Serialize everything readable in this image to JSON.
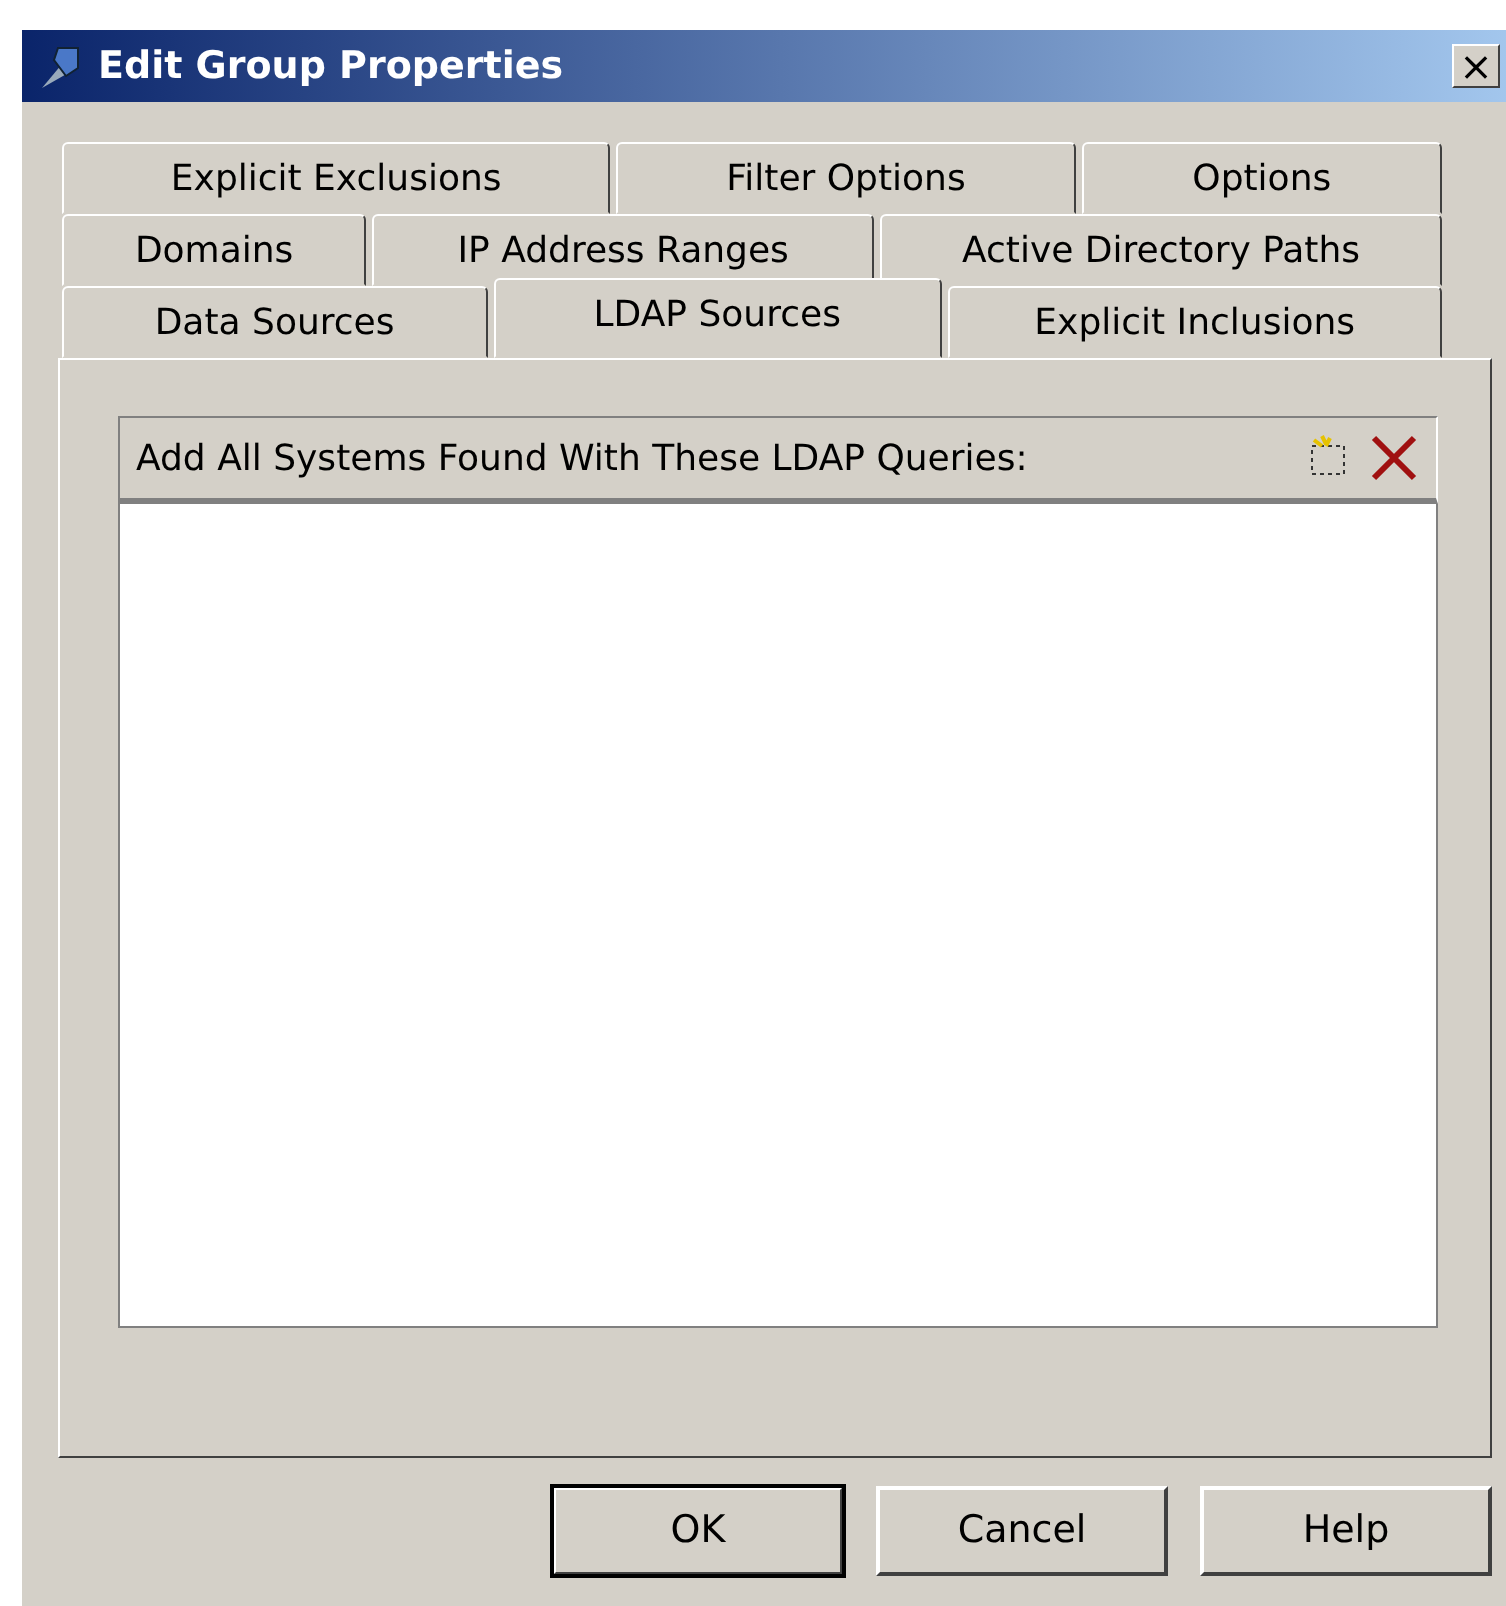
{
  "window": {
    "title": "Edit Group Properties",
    "close": "×"
  },
  "tab_rows": [
    {
      "tabs": [
        {
          "label": "Explicit Exclusions",
          "selected": false
        },
        {
          "label": "Filter Options",
          "selected": false
        },
        {
          "label": "Options",
          "selected": false
        }
      ]
    },
    {
      "tabs": [
        {
          "label": "Domains",
          "selected": false
        },
        {
          "label": "IP Address Ranges",
          "selected": false
        },
        {
          "label": "Active Directory Paths",
          "selected": false
        }
      ]
    },
    {
      "tabs": [
        {
          "label": "Data Sources",
          "selected": false
        },
        {
          "label": "LDAP Sources",
          "selected": true
        },
        {
          "label": "Explicit Inclusions",
          "selected": false
        }
      ]
    }
  ],
  "list": {
    "header": "Add All Systems Found With These LDAP Queries:"
  },
  "buttons": [
    {
      "label": "OK",
      "default": true
    },
    {
      "label": "Cancel",
      "default": false
    },
    {
      "label": "Help",
      "default": false
    }
  ]
}
